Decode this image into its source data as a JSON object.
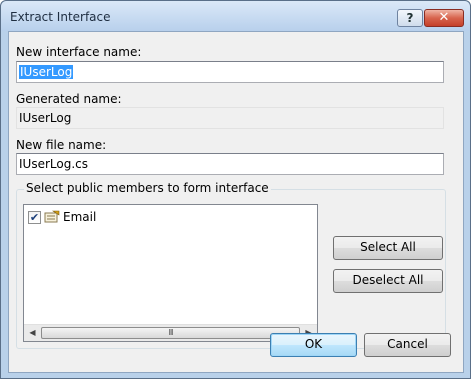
{
  "window": {
    "title": "Extract Interface",
    "help_label": "?",
    "close_label": "✕"
  },
  "form": {
    "interface_name_label": "New interface name:",
    "interface_name_value": "IUserLog",
    "generated_name_label": "Generated name:",
    "generated_name_value": "IUserLog",
    "file_name_label": "New file name:",
    "file_name_value": "IUserLog.cs"
  },
  "members": {
    "group_title": "Select public members to form interface",
    "items": [
      {
        "label": "Email",
        "checked": true,
        "icon": "property-icon"
      }
    ],
    "select_all_label": "Select All",
    "deselect_all_label": "Deselect All",
    "scrollbar": {
      "left_arrow": "◀",
      "right_arrow": "▶",
      "grip": "III"
    }
  },
  "footer": {
    "ok_label": "OK",
    "cancel_label": "Cancel"
  },
  "colors": {
    "selection": "#3399ff",
    "dialog_bg": "#f0f0f0",
    "frame": "#b9d1ea",
    "close_button": "#c5402a"
  }
}
